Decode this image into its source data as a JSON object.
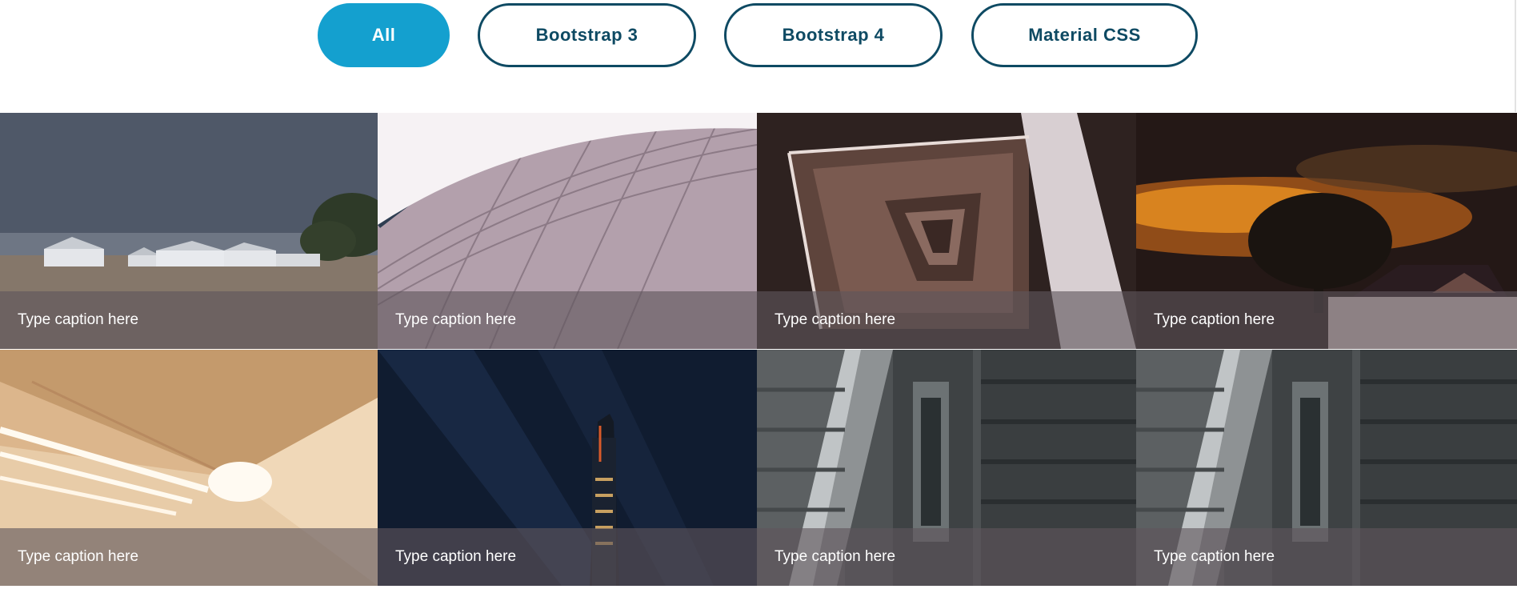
{
  "filters": [
    {
      "label": "All",
      "active": true
    },
    {
      "label": "Bootstrap 3",
      "active": false
    },
    {
      "label": "Bootstrap 4",
      "active": false
    },
    {
      "label": "Material CSS",
      "active": false
    }
  ],
  "gallery": [
    {
      "caption": "Type caption here",
      "scene": "farm-barns"
    },
    {
      "caption": "Type caption here",
      "scene": "curved-building"
    },
    {
      "caption": "Type caption here",
      "scene": "spiral-staircase"
    },
    {
      "caption": "Type caption here",
      "scene": "night-church-tree"
    },
    {
      "caption": "Type caption here",
      "scene": "light-tunnel"
    },
    {
      "caption": "Type caption here",
      "scene": "night-tower"
    },
    {
      "caption": "Type caption here",
      "scene": "escalator"
    },
    {
      "caption": "Type caption here",
      "scene": "escalator"
    }
  ],
  "colors": {
    "accent": "#14a0cf",
    "button_border": "#0e4a63",
    "caption_overlay": "#5f555c"
  }
}
